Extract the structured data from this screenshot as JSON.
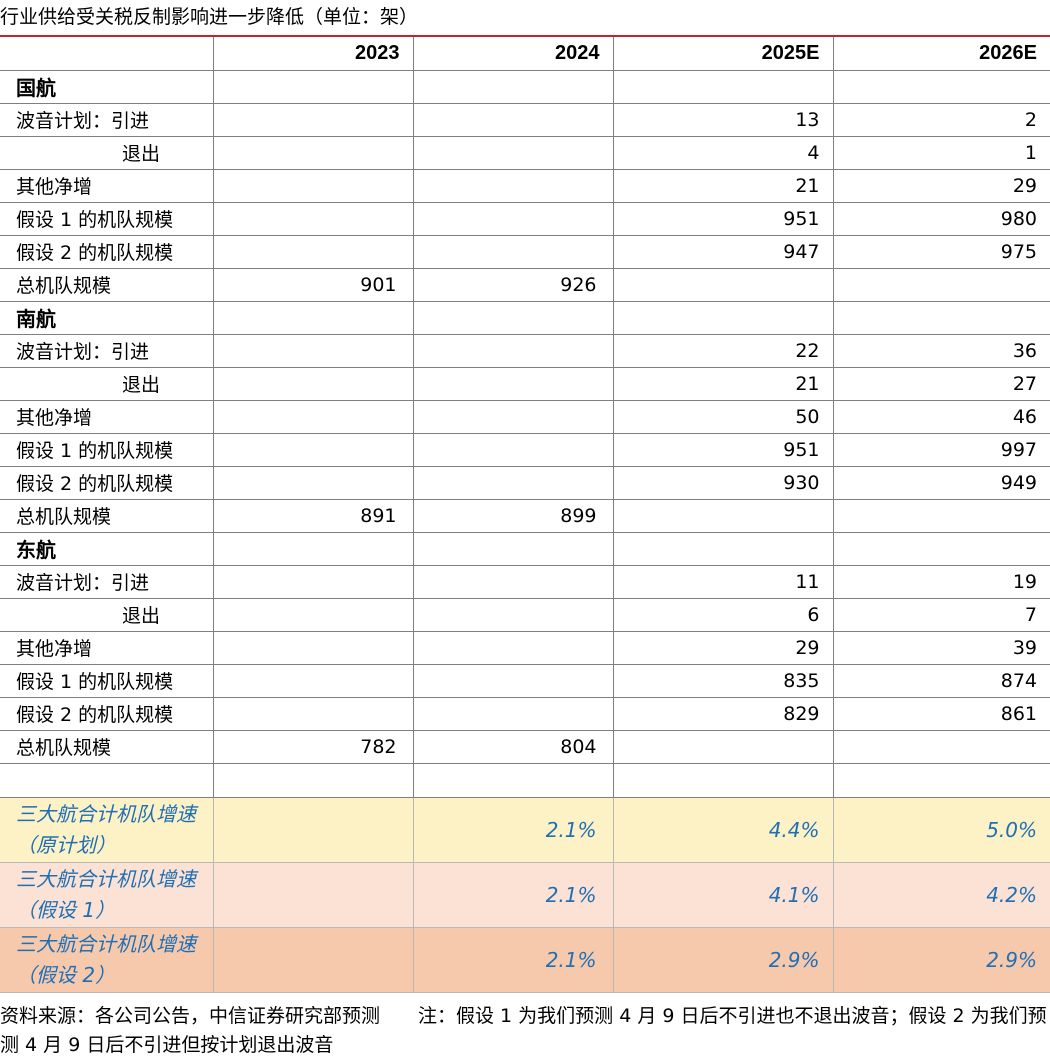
{
  "title": "行业供给受关税反制影响进一步降低（单位：架）",
  "columns": [
    "",
    "2023",
    "2024",
    "2025E",
    "2026E"
  ],
  "sections": [
    {
      "name": "国航",
      "rows": [
        {
          "label": "波音计划：引进",
          "indent": false,
          "values": [
            "",
            "",
            "13",
            "2"
          ]
        },
        {
          "label": "退出",
          "indent": true,
          "values": [
            "",
            "",
            "4",
            "1"
          ]
        },
        {
          "label": "其他净增",
          "indent": false,
          "values": [
            "",
            "",
            "21",
            "29"
          ]
        },
        {
          "label": "假设 1 的机队规模",
          "indent": false,
          "values": [
            "",
            "",
            "951",
            "980"
          ]
        },
        {
          "label": "假设 2 的机队规模",
          "indent": false,
          "values": [
            "",
            "",
            "947",
            "975"
          ]
        },
        {
          "label": "总机队规模",
          "indent": false,
          "values": [
            "901",
            "926",
            "",
            ""
          ]
        }
      ]
    },
    {
      "name": "南航",
      "rows": [
        {
          "label": "波音计划：引进",
          "indent": false,
          "values": [
            "",
            "",
            "22",
            "36"
          ]
        },
        {
          "label": "退出",
          "indent": true,
          "values": [
            "",
            "",
            "21",
            "27"
          ]
        },
        {
          "label": "其他净增",
          "indent": false,
          "values": [
            "",
            "",
            "50",
            "46"
          ]
        },
        {
          "label": "假设 1 的机队规模",
          "indent": false,
          "values": [
            "",
            "",
            "951",
            "997"
          ]
        },
        {
          "label": "假设 2 的机队规模",
          "indent": false,
          "values": [
            "",
            "",
            "930",
            "949"
          ]
        },
        {
          "label": "总机队规模",
          "indent": false,
          "values": [
            "891",
            "899",
            "",
            ""
          ]
        }
      ]
    },
    {
      "name": "东航",
      "rows": [
        {
          "label": "波音计划：引进",
          "indent": false,
          "values": [
            "",
            "",
            "11",
            "19"
          ]
        },
        {
          "label": "退出",
          "indent": true,
          "values": [
            "",
            "",
            "6",
            "7"
          ]
        },
        {
          "label": "其他净增",
          "indent": false,
          "values": [
            "",
            "",
            "29",
            "39"
          ]
        },
        {
          "label": "假设 1 的机队规模",
          "indent": false,
          "values": [
            "",
            "",
            "835",
            "874"
          ]
        },
        {
          "label": "假设 2 的机队规模",
          "indent": false,
          "values": [
            "",
            "",
            "829",
            "861"
          ]
        },
        {
          "label": "总机队规模",
          "indent": false,
          "values": [
            "782",
            "804",
            "",
            ""
          ]
        }
      ]
    }
  ],
  "growth_rows": [
    {
      "label": "三大航合计机队增速（原计划）",
      "values": [
        "",
        "2.1%",
        "4.4%",
        "5.0%"
      ],
      "color": "#fdf1c6"
    },
    {
      "label": "三大航合计机队增速（假设 1）",
      "values": [
        "",
        "2.1%",
        "4.1%",
        "4.2%"
      ],
      "color": "#fbe2d4"
    },
    {
      "label": "三大航合计机队增速（假设 2）",
      "values": [
        "",
        "2.1%",
        "2.9%",
        "2.9%"
      ],
      "color": "#f6c9ad"
    }
  ],
  "footer": "资料来源：各公司公告，中信证券研究部预测　　注：假设 1 为我们预测 4 月 9 日后不引进也不退出波音；假设 2 为我们预测 4 月 9 日后不引进但按计划退出波音",
  "colors": {
    "rule": "#c0262d",
    "growth_text": "#1f6fb5"
  }
}
